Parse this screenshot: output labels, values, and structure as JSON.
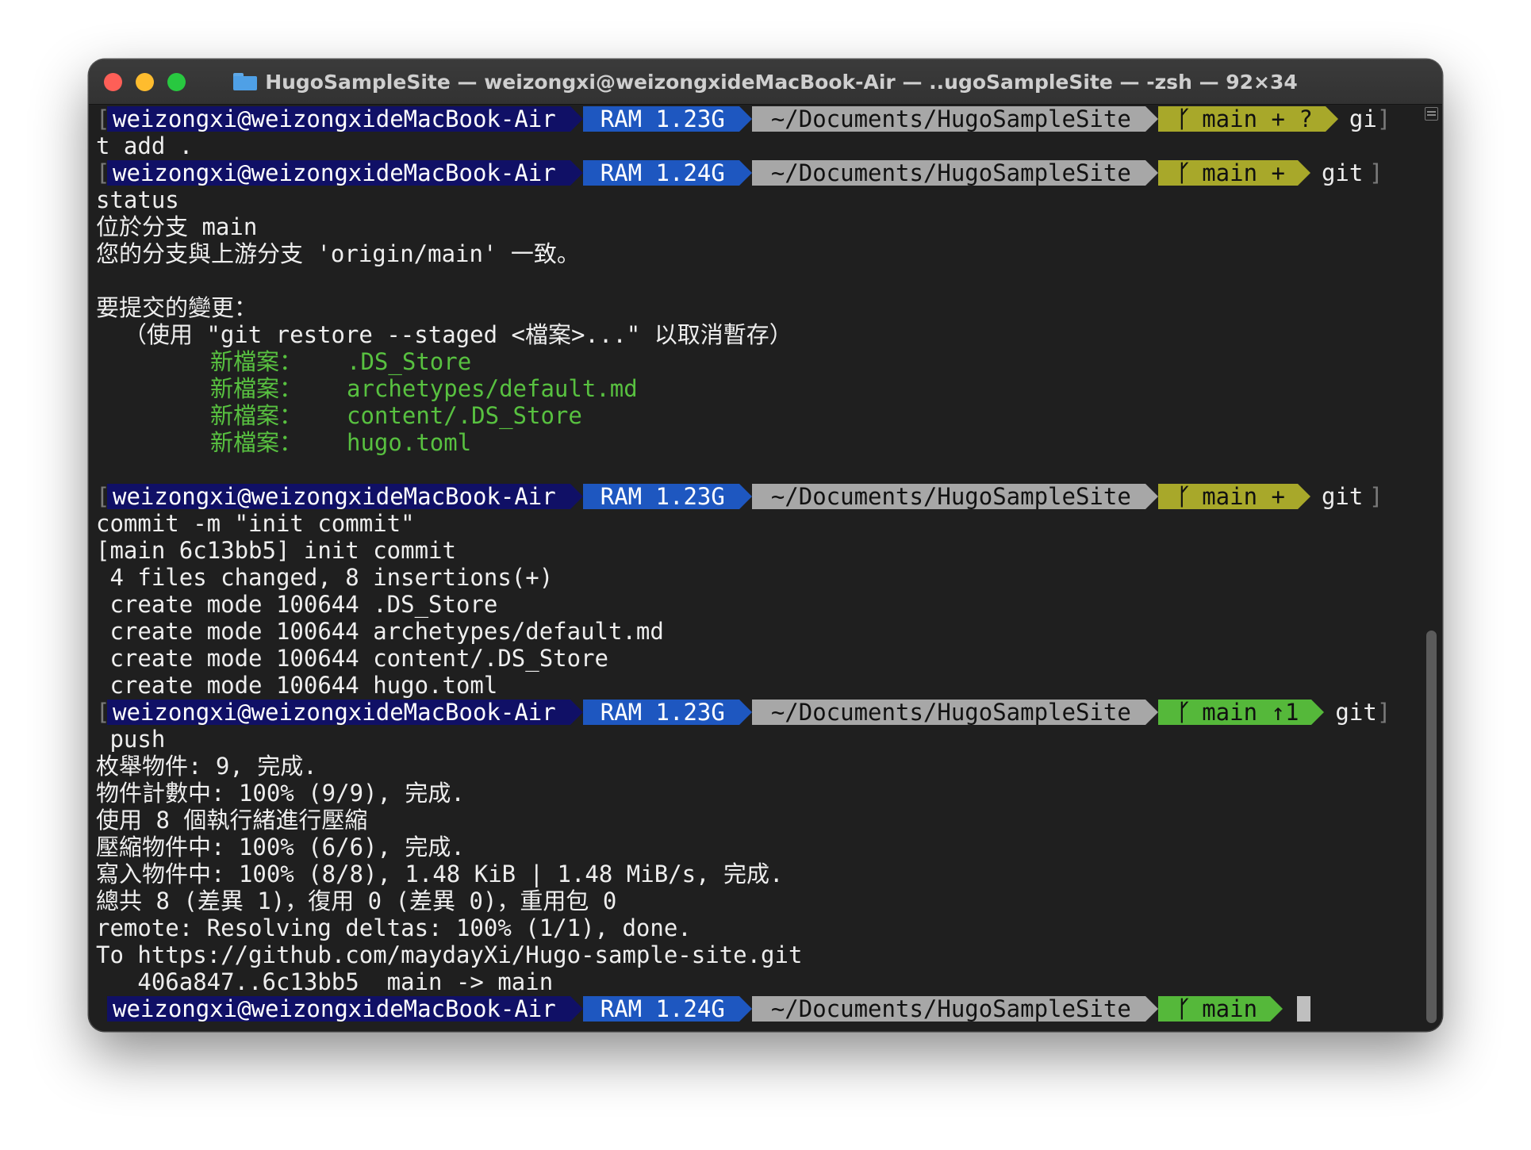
{
  "window": {
    "title": "HugoSampleSite — weizongxi@weizongxideMacBook-Air — ..ugoSampleSite — -zsh — 92×34"
  },
  "colors": {
    "user_segment": "#101066",
    "ram_segment": "#1e57c0",
    "path_segment": "#a7a7a7",
    "git_dirty": "#a8a82a",
    "git_clean": "#55b83a",
    "added_file_text": "#58c140"
  },
  "icons": [
    "folder-icon",
    "git-branch-icon",
    "close-icon",
    "minimize-icon",
    "maximize-icon"
  ],
  "prompts": [
    {
      "user": "weizongxi@weizongxideMacBook-Air",
      "ram": "RAM 1.23G",
      "path": "~/Documents/HugoSampleSite",
      "branch": "main + ?",
      "cmd": "gi",
      "wrap": "t add ."
    },
    {
      "user": "weizongxi@weizongxideMacBook-Air",
      "ram": "RAM 1.24G",
      "path": "~/Documents/HugoSampleSite",
      "branch": "main +",
      "cmd": "git",
      "wrap": "status"
    },
    {
      "user": "weizongxi@weizongxideMacBook-Air",
      "ram": "RAM 1.23G",
      "path": "~/Documents/HugoSampleSite",
      "branch": "main +",
      "cmd": "git",
      "wrap": "commit -m \"init commit\""
    },
    {
      "user": "weizongxi@weizongxideMacBook-Air",
      "ram": "RAM 1.23G",
      "path": "~/Documents/HugoSampleSite",
      "branch": "main ↑1",
      "cmd": "git",
      "wrap": " push"
    },
    {
      "user": "weizongxi@weizongxideMacBook-Air",
      "ram": "RAM 1.24G",
      "path": "~/Documents/HugoSampleSite",
      "branch": "main",
      "cmd": ""
    }
  ],
  "status_output": [
    "位於分支 main",
    "您的分支與上游分支 'origin/main' 一致。",
    "",
    "要提交的變更：",
    "  （使用 \"git restore --staged <檔案>...\" 以取消暫存）"
  ],
  "staged_files": [
    {
      "label": "新檔案：",
      "file": ".DS_Store"
    },
    {
      "label": "新檔案：",
      "file": "archetypes/default.md"
    },
    {
      "label": "新檔案：",
      "file": "content/.DS_Store"
    },
    {
      "label": "新檔案：",
      "file": "hugo.toml"
    }
  ],
  "commit_output": [
    "[main 6c13bb5] init commit",
    " 4 files changed, 8 insertions(+)",
    " create mode 100644 .DS_Store",
    " create mode 100644 archetypes/default.md",
    " create mode 100644 content/.DS_Store",
    " create mode 100644 hugo.toml"
  ],
  "push_output": [
    "枚舉物件: 9, 完成.",
    "物件計數中: 100% (9/9), 完成.",
    "使用 8 個執行緒進行壓縮",
    "壓縮物件中: 100% (6/6), 完成.",
    "寫入物件中: 100% (8/8), 1.48 KiB | 1.48 MiB/s, 完成.",
    "總共 8 (差異 1)，復用 0 (差異 0)，重用包 0",
    "remote: Resolving deltas: 100% (1/1), done.",
    "To https://github.com/maydayXi/Hugo-sample-site.git",
    "   406a847..6c13bb5  main -> main"
  ]
}
